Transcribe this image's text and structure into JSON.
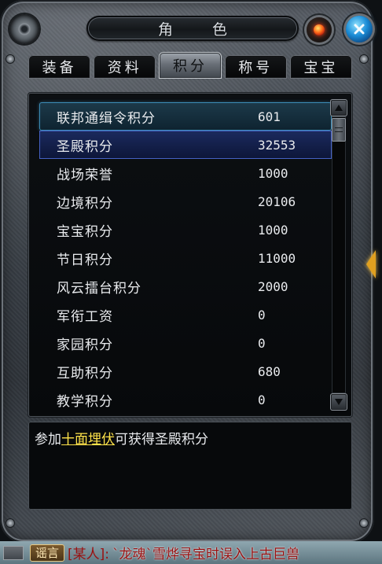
{
  "window": {
    "title": "角 色"
  },
  "tabs": [
    {
      "label": "装备",
      "active": false
    },
    {
      "label": "资料",
      "active": false
    },
    {
      "label": "积分",
      "active": true
    },
    {
      "label": "称号",
      "active": false
    },
    {
      "label": "宝宝",
      "active": false
    }
  ],
  "scores": [
    {
      "name": "联邦通缉令积分",
      "value": "601"
    },
    {
      "name": "圣殿积分",
      "value": "32553"
    },
    {
      "name": "战场荣誉",
      "value": "1000"
    },
    {
      "name": "边境积分",
      "value": "20106"
    },
    {
      "name": "宝宝积分",
      "value": "1000"
    },
    {
      "name": "节日积分",
      "value": "11000"
    },
    {
      "name": "风云擂台积分",
      "value": "2000"
    },
    {
      "name": "军衔工资",
      "value": "0"
    },
    {
      "name": "家园积分",
      "value": "0"
    },
    {
      "name": "互助积分",
      "value": "680"
    },
    {
      "name": "教学积分",
      "value": "0"
    }
  ],
  "description": {
    "prefix": "参加",
    "link": "十面埋伏",
    "suffix": "可获得圣殿积分"
  },
  "chat": {
    "channel": "谣言",
    "speaker": "[某人]:",
    "message": "`龙魂`雪烨寻宝时误入上古巨兽"
  },
  "colors": {
    "link": "#ffe34a",
    "hover_row": "#3d8bb5",
    "selected_row": "#4561c4",
    "chat_text": "#9a1010"
  }
}
